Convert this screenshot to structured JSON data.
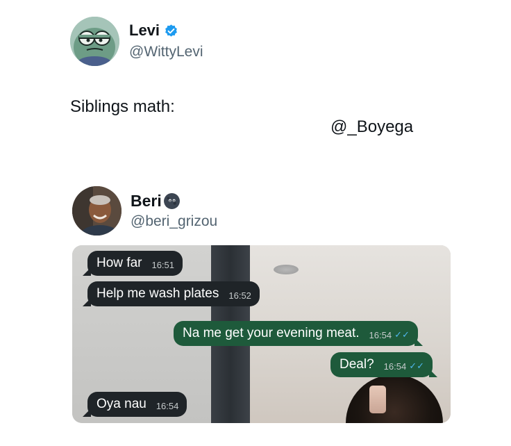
{
  "tweet": {
    "author": {
      "name": "Levi",
      "handle": "@WittyLevi",
      "verified": true,
      "avatar_icon": "cartoon-fish-avatar"
    },
    "text": "Siblings math:",
    "mention": "@_Boyega"
  },
  "quoted": {
    "author": {
      "name": "Beri",
      "handle": "@beri_grizou",
      "emoji_icon": "new-moon-face-emoji",
      "avatar_icon": "man-photo-avatar"
    },
    "chat": {
      "messages": [
        {
          "direction": "in",
          "text": "How far",
          "time": "16:51"
        },
        {
          "direction": "in",
          "text": "Help me wash plates",
          "time": "16:52"
        },
        {
          "direction": "out",
          "text": "Na me get your evening meat.",
          "time": "16:54",
          "ticks": "✓✓"
        },
        {
          "direction": "out",
          "text": "Deal?",
          "time": "16:54",
          "ticks": "✓✓"
        },
        {
          "direction": "in",
          "text": "Oya nau",
          "time": "16:54"
        }
      ]
    }
  },
  "colors": {
    "incoming_bubble": "#1f2428",
    "outgoing_bubble": "#1e5a3b",
    "read_ticks": "#4fb6ec",
    "verified_badge": "#1d9bf0",
    "handle_text": "#536471"
  }
}
